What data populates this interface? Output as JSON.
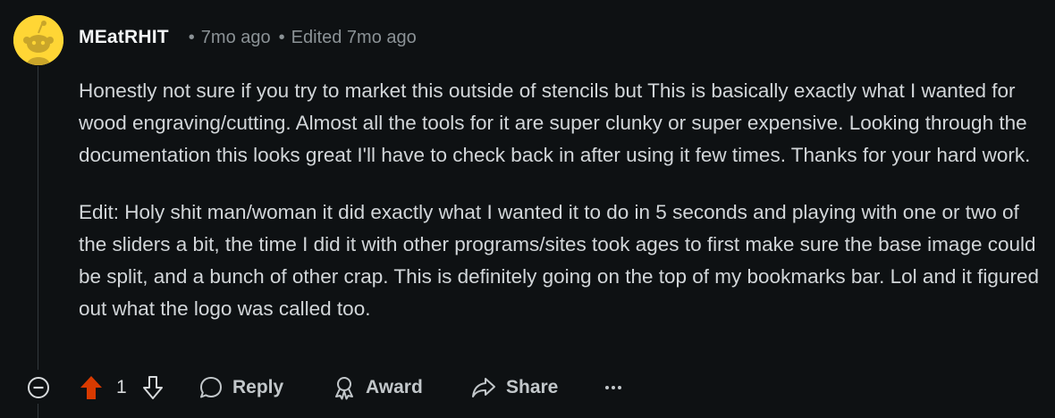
{
  "comment": {
    "author": "MEatRHIT",
    "time_ago": "7mo ago",
    "edited": "Edited 7mo ago",
    "separator": "•",
    "paragraphs": [
      "Honestly not sure if you try to market this outside of stencils but This is basically exactly what I wanted for wood engraving/cutting. Almost all the tools for it are super clunky or super expensive. Looking through the documentation this looks great I'll have to check back in after using it few times. Thanks for your hard work.",
      "Edit: Holy shit man/woman it did exactly what I wanted it to do in 5 seconds and playing with one or two of the sliders a bit, the time I did it with other programs/sites took ages to first make sure the base image could be split, and a bunch of other crap. This is definitely going on the top of my bookmarks bar. Lol and it figured out what the logo was called too."
    ],
    "score": "1",
    "actions": {
      "reply": "Reply",
      "award": "Award",
      "share": "Share"
    },
    "icons": {
      "collapse": "collapse-thread-icon",
      "upvote": "upvote-arrow-icon",
      "downvote": "downvote-arrow-icon",
      "reply": "chat-bubble-icon",
      "award": "award-ribbon-icon",
      "share": "share-arrow-icon",
      "more": "more-options-icon"
    },
    "colors": {
      "background": "#0e1113",
      "upvote_active": "#d93a00",
      "avatar_bg": "#ffd635",
      "text": "#d2d6d9",
      "meta": "#8b9296"
    }
  }
}
